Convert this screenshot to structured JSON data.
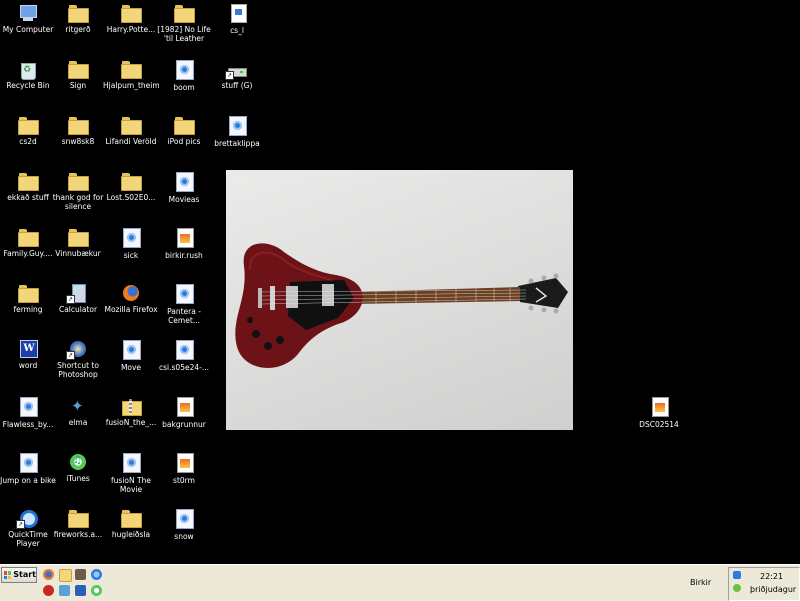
{
  "desktop": {
    "icons": [
      {
        "label": "My Computer",
        "type": "computer"
      },
      {
        "label": "ritgerð",
        "type": "folder"
      },
      {
        "label": "Harry.Potte...",
        "type": "folder"
      },
      {
        "label": "[1982] No Life\n'til Leather",
        "type": "folder"
      },
      {
        "label": "cs_l",
        "type": "file"
      },
      {
        "label": "Recycle Bin",
        "type": "bin"
      },
      {
        "label": "Sign",
        "type": "folder"
      },
      {
        "label": "Hjalpum_theim",
        "type": "folder"
      },
      {
        "label": "boom",
        "type": "media"
      },
      {
        "label": "stuff (G)",
        "type": "drive"
      },
      {
        "label": "cs2d",
        "type": "folder"
      },
      {
        "label": "snw8sk8",
        "type": "folder"
      },
      {
        "label": "Lifandi Veröld",
        "type": "folder"
      },
      {
        "label": "iPod pics",
        "type": "folder"
      },
      {
        "label": "brettaklippa",
        "type": "media"
      },
      {
        "label": "ekkað stuff",
        "type": "folder"
      },
      {
        "label": "thank god for\nsilence",
        "type": "folder"
      },
      {
        "label": "Lost.S02E0...",
        "type": "folder"
      },
      {
        "label": "Movieas",
        "type": "media"
      },
      {
        "label": "Family.Guy....",
        "type": "folder"
      },
      {
        "label": "Vinnubækur",
        "type": "folder"
      },
      {
        "label": "sick",
        "type": "media"
      },
      {
        "label": "birkir.rush",
        "type": "image"
      },
      {
        "label": "ferming",
        "type": "folder"
      },
      {
        "label": "Calculator",
        "type": "calc"
      },
      {
        "label": "Mozilla Firefox",
        "type": "firefox"
      },
      {
        "label": "Pantera -\nCemet...",
        "type": "media"
      },
      {
        "label": "word",
        "type": "word"
      },
      {
        "label": "Shortcut to\nPhotoshop",
        "type": "photoshop"
      },
      {
        "label": "Move",
        "type": "media"
      },
      {
        "label": "csi.s05e24-...",
        "type": "media"
      },
      {
        "label": "Flawless_by...",
        "type": "media"
      },
      {
        "label": "elma",
        "type": "elma"
      },
      {
        "label": "fusioN_the_...",
        "type": "zip"
      },
      {
        "label": "bakgrunnur",
        "type": "image"
      },
      {
        "label": "DSC02514",
        "type": "image"
      },
      {
        "label": "Jump on a bike",
        "type": "media"
      },
      {
        "label": "iTunes",
        "type": "itunes"
      },
      {
        "label": "fusioN The\nMovie",
        "type": "media"
      },
      {
        "label": "st0rm",
        "type": "image"
      },
      {
        "label": "QuickTime\nPlayer",
        "type": "quicktime"
      },
      {
        "label": "fireworks.a...",
        "type": "folder"
      },
      {
        "label": "hugleiðsla",
        "type": "folder"
      },
      {
        "label": "snow",
        "type": "media"
      }
    ]
  },
  "taskbar": {
    "start_label": "Start",
    "user_name": "Birkir",
    "clock_time": "22:21",
    "clock_day": "þriðjudagur"
  },
  "colors": {
    "desktop_bg": "#000000",
    "taskbar_bg": "#ece9d8",
    "guitar_body": "#7a1416",
    "pickguard": "#111111"
  }
}
